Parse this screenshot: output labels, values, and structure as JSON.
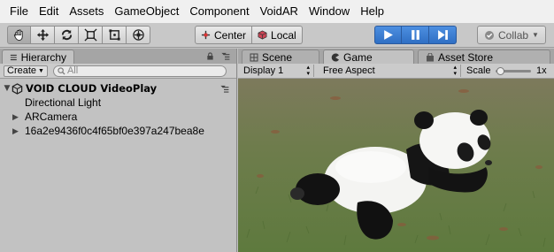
{
  "menu": [
    "File",
    "Edit",
    "Assets",
    "GameObject",
    "Component",
    "VoidAR",
    "Window",
    "Help"
  ],
  "toolbar": {
    "tools": [
      "hand-icon",
      "move-icon",
      "rotate-icon",
      "scale-icon",
      "rect-icon",
      "transform-icon"
    ],
    "pivot_center": "Center",
    "pivot_local": "Local",
    "collab_label": "Collab"
  },
  "hierarchy": {
    "tab_label": "Hierarchy",
    "create_label": "Create",
    "search_placeholder": "All",
    "scene_name": "VOID CLOUD VideoPlay",
    "items": [
      "Directional Light",
      "ARCamera",
      "16a2e9436f0c4f65bf0e397a247bea8e"
    ]
  },
  "game": {
    "tabs": [
      "Scene",
      "Game",
      "Asset Store"
    ],
    "display": "Display 1",
    "aspect": "Free Aspect",
    "scale_label": "Scale",
    "scale_value": "1x"
  },
  "colors": {
    "play_blue": "#3a7bd5",
    "panel_gray": "#c2c2c2"
  }
}
